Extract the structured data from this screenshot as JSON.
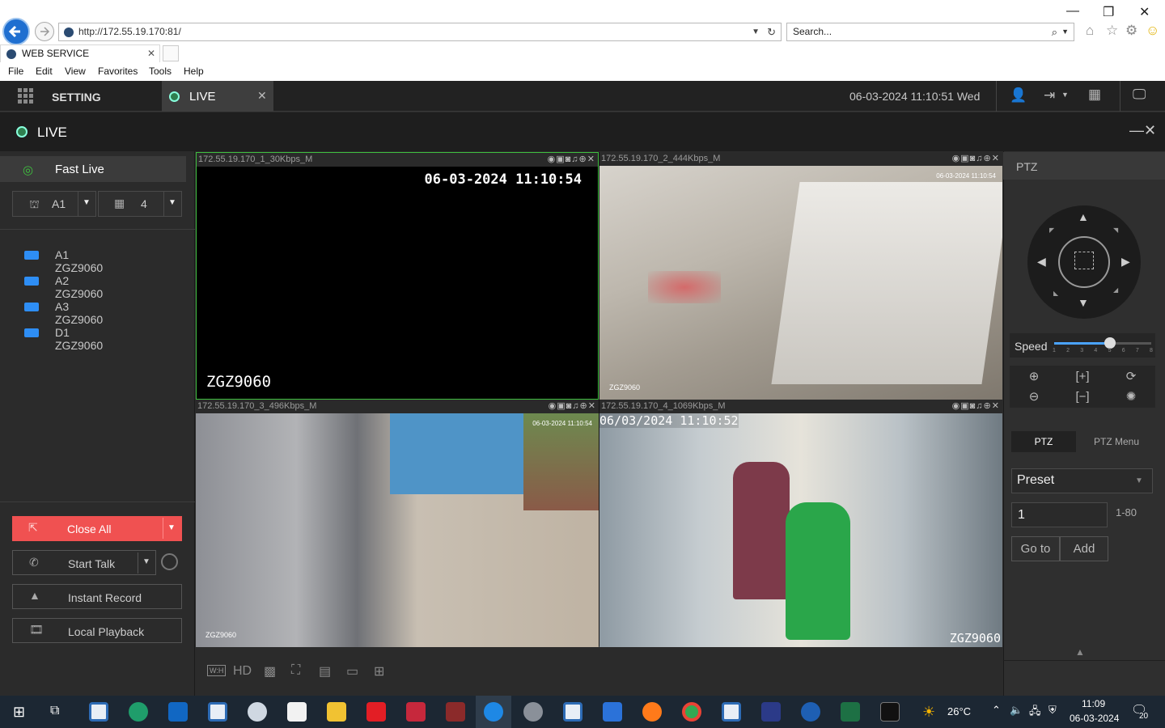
{
  "browser": {
    "url": "http://172.55.19.170:81/",
    "search_placeholder": "Search...",
    "tab_title": "WEB SERVICE",
    "menu": [
      "File",
      "Edit",
      "View",
      "Favorites",
      "Tools",
      "Help"
    ]
  },
  "app": {
    "nav_setting": "SETTING",
    "nav_live": "LIVE",
    "datetime": "06-03-2024 11:10:51 Wed",
    "page_title": "LIVE"
  },
  "left": {
    "fast_live": "Fast Live",
    "stream_select": "A1",
    "layout_select": "4",
    "channels": [
      "A1 ZGZ9060",
      "A2 ZGZ9060",
      "A3 ZGZ9060",
      "D1 ZGZ9060"
    ],
    "close_all": "Close All",
    "start_talk": "Start Talk",
    "instant_record": "Instant Record",
    "local_playback": "Local Playback"
  },
  "video": {
    "tiles": [
      {
        "label": "172.55.19.170_1_30Kbps_M",
        "osd_time": "06-03-2024 11:10:54",
        "osd_name": "ZGZ9060"
      },
      {
        "label": "172.55.19.170_2_444Kbps_M",
        "osd_time": "06-03-2024 11:10:54",
        "osd_name": "ZGZ9060"
      },
      {
        "label": "172.55.19.170_3_496Kbps_M",
        "osd_time": "06-03-2024 11:10:54",
        "osd_name": "ZGZ9060"
      },
      {
        "label": "172.55.19.170_4_1069Kbps_M",
        "osd_time": "06/03/2024 11:10:52",
        "osd_name": "ZGZ9060"
      }
    ],
    "toolbar": {
      "wh": "W:H",
      "hd": "HD"
    }
  },
  "ptz": {
    "header": "PTZ",
    "speed_label": "Speed",
    "speed_ticks": [
      "1",
      "2",
      "3",
      "4",
      "5",
      "6",
      "7",
      "8"
    ],
    "speed_value": 5,
    "tab_ptz": "PTZ",
    "tab_menu": "PTZ Menu",
    "preset_select": "Preset",
    "preset_value": "1",
    "preset_range": "1-80",
    "goto": "Go to",
    "add": "Add"
  },
  "taskbar": {
    "weather": "26°C",
    "time": "11:09",
    "date": "06-03-2024",
    "notifications": "20"
  },
  "colors": {
    "accent_red": "#f05151",
    "active_green": "#3fbf3f",
    "camera_blue": "#2e8ef5"
  }
}
